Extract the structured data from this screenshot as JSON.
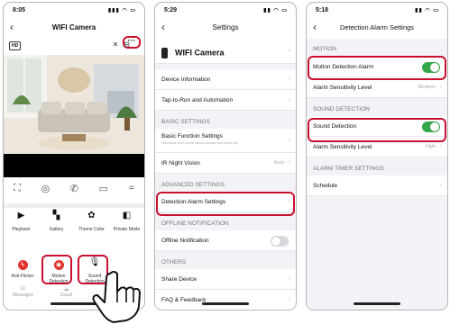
{
  "phone1": {
    "time": "8:05",
    "title": "WIFI Camera",
    "more_glyph": "···",
    "hd": "HD",
    "grid1": [
      {
        "label": "Playback",
        "icon": "play-icon"
      },
      {
        "label": "Gallery",
        "icon": "gallery-icon"
      },
      {
        "label": "Theme Color",
        "icon": "palette-icon"
      },
      {
        "label": "Private Mode",
        "icon": "privacy-icon"
      }
    ],
    "grid2": [
      {
        "label": "Anti-Flicker",
        "icon": "flicker-icon"
      },
      {
        "label": "Motion Detection",
        "icon": "motion-icon"
      },
      {
        "label": "Sound Detection",
        "icon": "mic-icon"
      }
    ],
    "bottom": {
      "messages": "Messages",
      "cloud": "Cloud"
    }
  },
  "phone2": {
    "time": "5:29",
    "title": "Settings",
    "device_name": "WIFI Camera",
    "rows": {
      "device_info": "Device Information",
      "tap_run": "Tap-to-Run and Automation",
      "basic_header": "BASIC SETTINGS",
      "basic_func": "Basic Function Settings",
      "basic_func_sub": "Information such as the status indicator and screen flip",
      "ir_night": "IR Night Vision",
      "ir_value": "Auto",
      "adv_header": "ADVANCED SETTINGS",
      "detection_alarm": "Detection Alarm Settings",
      "offline_header": "OFFLINE NOTIFICATION",
      "offline_notif": "Offline Notification",
      "others_header": "OTHERS",
      "share": "Share Device",
      "faq": "FAQ & Feedback"
    }
  },
  "phone3": {
    "time": "5:18",
    "title": "Detection Alarm Settings",
    "motion_header": "MOTION",
    "motion_alarm": "Motion Detection Alarm",
    "motion_sens": "Alarm Sensitivity Level",
    "motion_sens_val": "Medium",
    "sound_header": "SOUND DETECTION",
    "sound_det": "Sound Detection",
    "sound_sens": "Alarm Sensitivity Level",
    "sound_sens_val": "High",
    "timer_header": "ALARM TIMER SETTINGS",
    "schedule": "Schedule"
  },
  "colors": {
    "highlight": "#c8102e",
    "toggle_on": "#34a84a"
  }
}
